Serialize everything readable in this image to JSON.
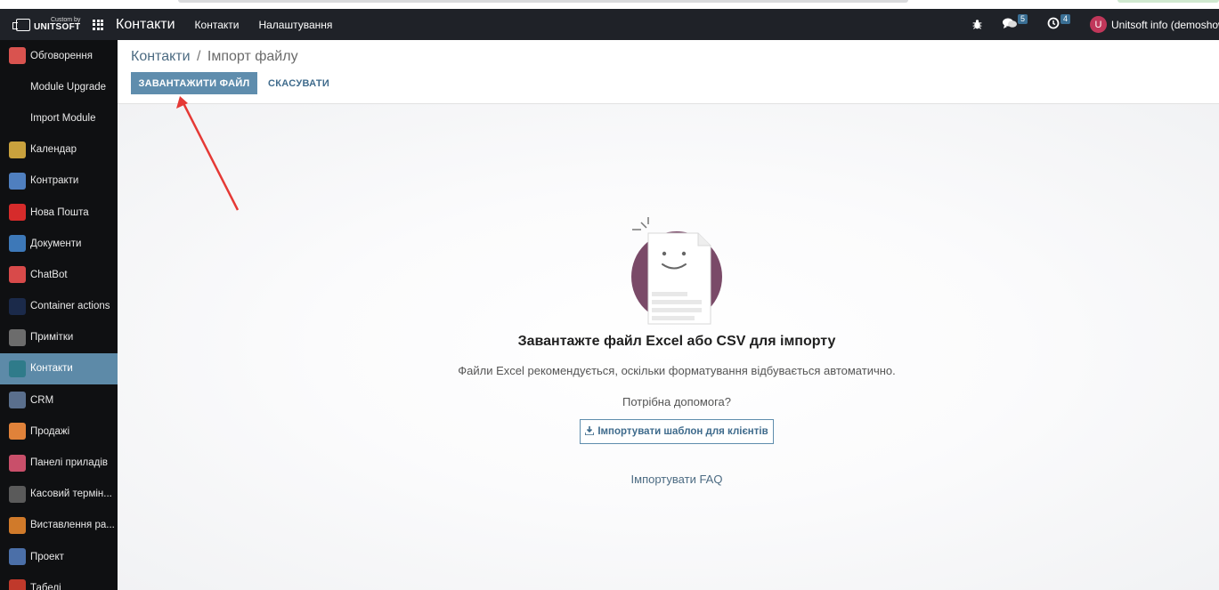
{
  "navbar": {
    "brand_small": "Custom by",
    "brand_big": "UNITSOFT",
    "app_title": "Контакти",
    "menu": [
      "Контакти",
      "Налаштування"
    ],
    "messages_count": "5",
    "activities_count": "4",
    "user_initial": "U",
    "user_name": "Unitsoft info (demoshow"
  },
  "sidebar": {
    "items": [
      {
        "label": "Обговорення",
        "icon": "chat-icon",
        "color": "#d9534f"
      },
      {
        "label": "Module Upgrade",
        "sub": true
      },
      {
        "label": "Import Module",
        "sub": true
      },
      {
        "label": "Календар",
        "icon": "calendar-icon",
        "color": "#c9a13d"
      },
      {
        "label": "Контракти",
        "icon": "contract-icon",
        "color": "#4f7fbf"
      },
      {
        "label": "Нова Пошта",
        "icon": "nova-poshta-icon",
        "color": "#d62b2b"
      },
      {
        "label": "Документи",
        "icon": "documents-icon",
        "color": "#3d78b8"
      },
      {
        "label": "ChatBot",
        "icon": "chatbot-icon",
        "color": "#d84a4a"
      },
      {
        "label": "Container actions",
        "icon": "container-icon",
        "color": "#1b2a4a"
      },
      {
        "label": "Примітки",
        "icon": "notes-icon",
        "color": "#6c6c6c"
      },
      {
        "label": "Контакти",
        "icon": "contacts-icon",
        "color": "#2f7b8a",
        "active": true
      },
      {
        "label": "CRM",
        "icon": "crm-icon",
        "color": "#5a6f8d"
      },
      {
        "label": "Продажі",
        "icon": "sales-icon",
        "color": "#e0823a"
      },
      {
        "label": "Панелі приладів",
        "icon": "dashboard-icon",
        "color": "#c94f6a"
      },
      {
        "label": "Касовий термін...",
        "icon": "pos-icon",
        "color": "#5a5a5a"
      },
      {
        "label": "Виставлення ра...",
        "icon": "invoicing-icon",
        "color": "#d07a2a"
      },
      {
        "label": "Проект",
        "icon": "project-icon",
        "color": "#4b6fa8"
      },
      {
        "label": "Табелі",
        "icon": "timesheet-icon",
        "color": "#c0392b"
      }
    ]
  },
  "control_panel": {
    "breadcrumb_parent": "Контакти",
    "breadcrumb_sep": "/",
    "breadcrumb_current": "Імпорт файлу",
    "upload_button": "ЗАВАНТАЖИТИ ФАЙЛ",
    "cancel_button": "СКАСУВАТИ"
  },
  "content": {
    "heading": "Завантажте файл Excel або CSV для імпорту",
    "subtext": "Файли Excel рекомендується, оскільки форматування відбувається автоматично.",
    "help": "Потрібна допомога?",
    "template_button": "Імпортувати шаблон для клієнтів",
    "faq_link": "Імпортувати FAQ"
  },
  "colors": {
    "navbar": "#1f2228",
    "sidebar": "#0f1012",
    "active_item": "#5d8aa8",
    "primary": "#5f8dad",
    "illustration_circle": "#7a4a68",
    "annotation_arrow": "#e53935"
  }
}
